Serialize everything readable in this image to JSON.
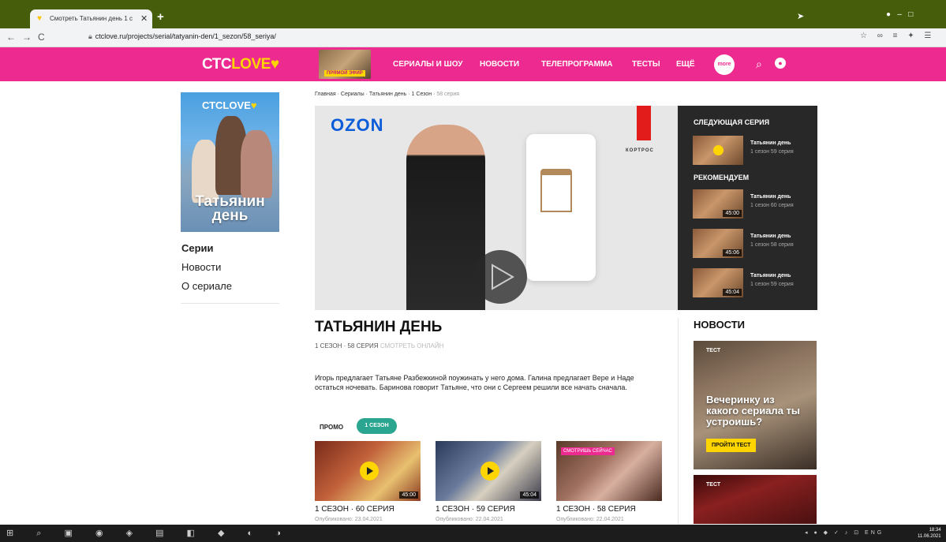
{
  "browser": {
    "tab_title": "Смотреть Татьянин день 1 с",
    "url": "ctclove.ru/projects/serial/tatyanin-den/1_sezon/58_seriya/"
  },
  "site": {
    "logo_ctc": "СТС",
    "logo_love": "LOVE",
    "live_label": "ПРЯМОЙ ЭФИР",
    "nav": [
      "СЕРИАЛЫ И ШОУ",
      "НОВОСТИ",
      "ТЕЛЕПРОГРАММА",
      "ТЕСТЫ",
      "ЕЩЁ"
    ],
    "more_badge": "more"
  },
  "sidebar": {
    "poster_logo_ctc": "СТС",
    "poster_logo_love": "LOVE",
    "poster_title_1": "Татьянин",
    "poster_title_2": "день",
    "items": [
      "Серии",
      "Новости",
      "О сериале"
    ]
  },
  "breadcrumb": {
    "items": [
      "Главная",
      "Сериалы",
      "Татьянин день",
      "1 Сезон"
    ],
    "current": "58 серия"
  },
  "player": {
    "ad_brand": "OZON",
    "ad_partner": "КОРТРОС"
  },
  "recommend": {
    "next_heading": "СЛЕДУЮЩАЯ СЕРИЯ",
    "rec_heading": "РЕКОМЕНДУЕМ",
    "next": {
      "title": "Татьянин день",
      "sub": "1 сезон 59 серия"
    },
    "items": [
      {
        "title": "Татьянин день",
        "sub": "1 сезон 60 серия",
        "duration": "45:00"
      },
      {
        "title": "Татьянин день",
        "sub": "1 сезон 58 серия",
        "duration": "45:06"
      },
      {
        "title": "Татьянин день",
        "sub": "1 сезон 59 серия",
        "duration": "45:04"
      }
    ]
  },
  "show": {
    "title": "ТАТЬЯНИН ДЕНЬ",
    "season": "1 СЕЗОН",
    "episode": "58 СЕРИЯ",
    "watch_online": "СМОТРЕТЬ ОНЛАЙН",
    "description": "Игорь предлагает Татьяне Разбежкиной поужинать у него дома. Галина предлагает Вере и Наде остаться ночевать. Баринова говорит Татьяне, что они с Сергеем решили все начать сначала.",
    "promo_label": "ПРОМО",
    "season_pill": "1 СЕЗОН"
  },
  "episodes": [
    {
      "title": "1 СЕЗОН · 60 СЕРИЯ",
      "date": "Опубликовано: 23.04.2021",
      "duration": "45:00",
      "now": ""
    },
    {
      "title": "1 СЕЗОН · 59 СЕРИЯ",
      "date": "Опубликовано: 22.04.2021",
      "duration": "45:04",
      "now": ""
    },
    {
      "title": "1 СЕЗОН · 58 СЕРИЯ",
      "date": "Опубликовано: 22.04.2021",
      "duration": "",
      "now": "СМОТРИШЬ СЕЙЧАС"
    }
  ],
  "news": {
    "heading": "НОВОСТИ",
    "card1_tag": "ТЕСТ",
    "card1_headline": "Вечеринку из какого сериала ты устроишь?",
    "card1_button": "ПРОЙТИ ТЕСТ",
    "card2_tag": "ТЕСТ"
  },
  "taskbar": {
    "lang": "ENG",
    "time": "18:34",
    "date": "11.06.2021"
  },
  "colors": {
    "brand_pink": "#ec2a8f",
    "brand_yellow": "#ffd500",
    "season_green": "#2aa58f",
    "tabbar_green": "#465e0c"
  }
}
